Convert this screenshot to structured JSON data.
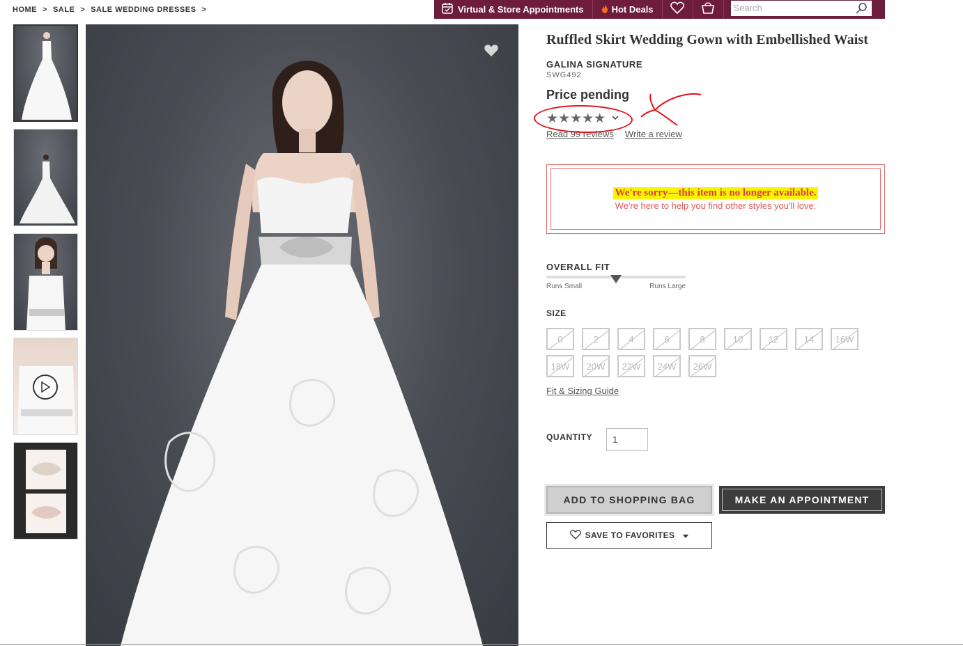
{
  "breadcrumb": [
    {
      "label": "HOME"
    },
    {
      "label": "SALE"
    },
    {
      "label": "SALE WEDDING DRESSES"
    }
  ],
  "breadcrumb_separator": ">",
  "topbar": {
    "appointments_label": "Virtual & Store Appointments",
    "deals_label": "Hot Deals",
    "search_placeholder": "Search",
    "background_color": "#6d1c3c"
  },
  "product": {
    "title": "Ruffled Skirt Wedding Gown with Embellished Waist",
    "brand": "GALINA SIGNATURE",
    "sku": "SWG492",
    "price": "Price pending",
    "stars": "★★★★★",
    "rating_stars": 5,
    "read_reviews": "Read 99 reviews",
    "write_review": "Write a review"
  },
  "notice": {
    "title": "We're sorry—this item is no  longer available.",
    "subtitle": "We're here to help you find other styles you'll love.",
    "color": "#e53a3a",
    "highlight_color": "#f8f400"
  },
  "fit": {
    "label": "OVERALL FIT",
    "min_label": "Runs Small",
    "max_label": "Runs Large",
    "value_fraction": 0.5
  },
  "size": {
    "label": "SIZE",
    "options": [
      "0",
      "2",
      "4",
      "6",
      "8",
      "10",
      "12",
      "14",
      "16W",
      "18W",
      "20W",
      "22W",
      "24W",
      "26W"
    ],
    "guide_label": "Fit & Sizing Guide"
  },
  "quantity": {
    "label": "QUANTITY",
    "value": "1"
  },
  "buttons": {
    "add_to_bag": "ADD TO SHOPPING BAG",
    "make_appointment": "MAKE AN APPOINTMENT",
    "save_to_favorites": "SAVE TO FAVORITES"
  },
  "icons": {
    "calendar": "calendar-icon",
    "flame": "flame-icon",
    "heart": "heart-icon",
    "bag": "shopping-bag-icon",
    "search": "search-icon",
    "play": "play-icon",
    "chevron": "chevron-down-icon"
  },
  "annotation_color": "#e2121a"
}
